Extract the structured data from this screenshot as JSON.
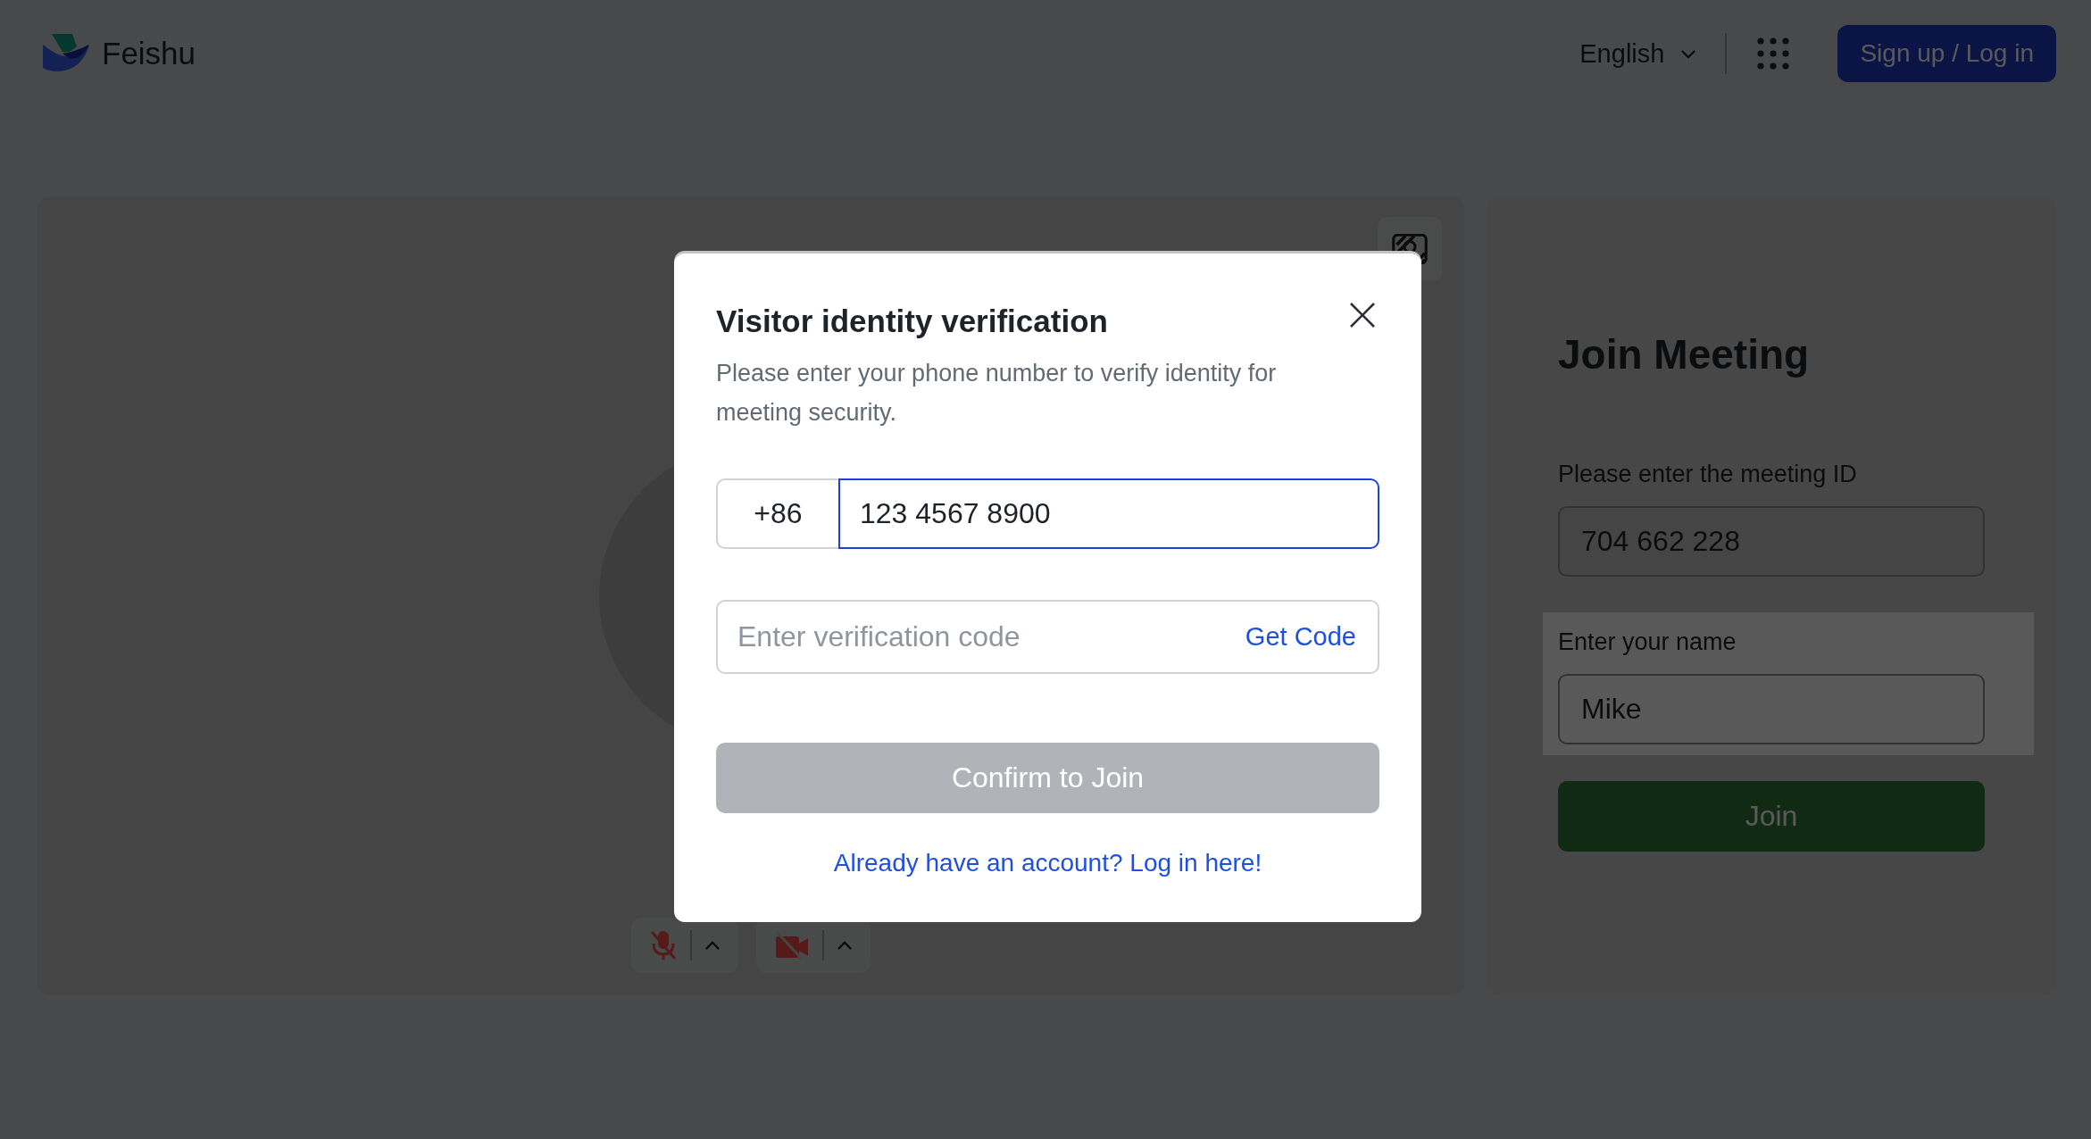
{
  "header": {
    "logo_text": "Feishu",
    "language": "English",
    "signup_button": "Sign up / Log in"
  },
  "preview": {
    "mic_muted": true,
    "camera_off": true
  },
  "join_panel": {
    "title": "Join Meeting",
    "meeting_id_label": "Please enter the meeting ID",
    "meeting_id": "704 662 228",
    "name_label": "Enter your name",
    "name": "Mike",
    "name_highlighted": true,
    "join_button": "Join"
  },
  "dialog": {
    "title": "Visitor identity verification",
    "description": "Please enter your phone number to verify identity for meeting security.",
    "country_code": "+86",
    "phone": "123 4567 8900",
    "phone_focused": true,
    "code_placeholder": "Enter verification code",
    "get_code": "Get Code",
    "confirm": {
      "label": "Confirm to Join",
      "disabled": true
    },
    "login_link": "Already have an account? Log in here!"
  }
}
